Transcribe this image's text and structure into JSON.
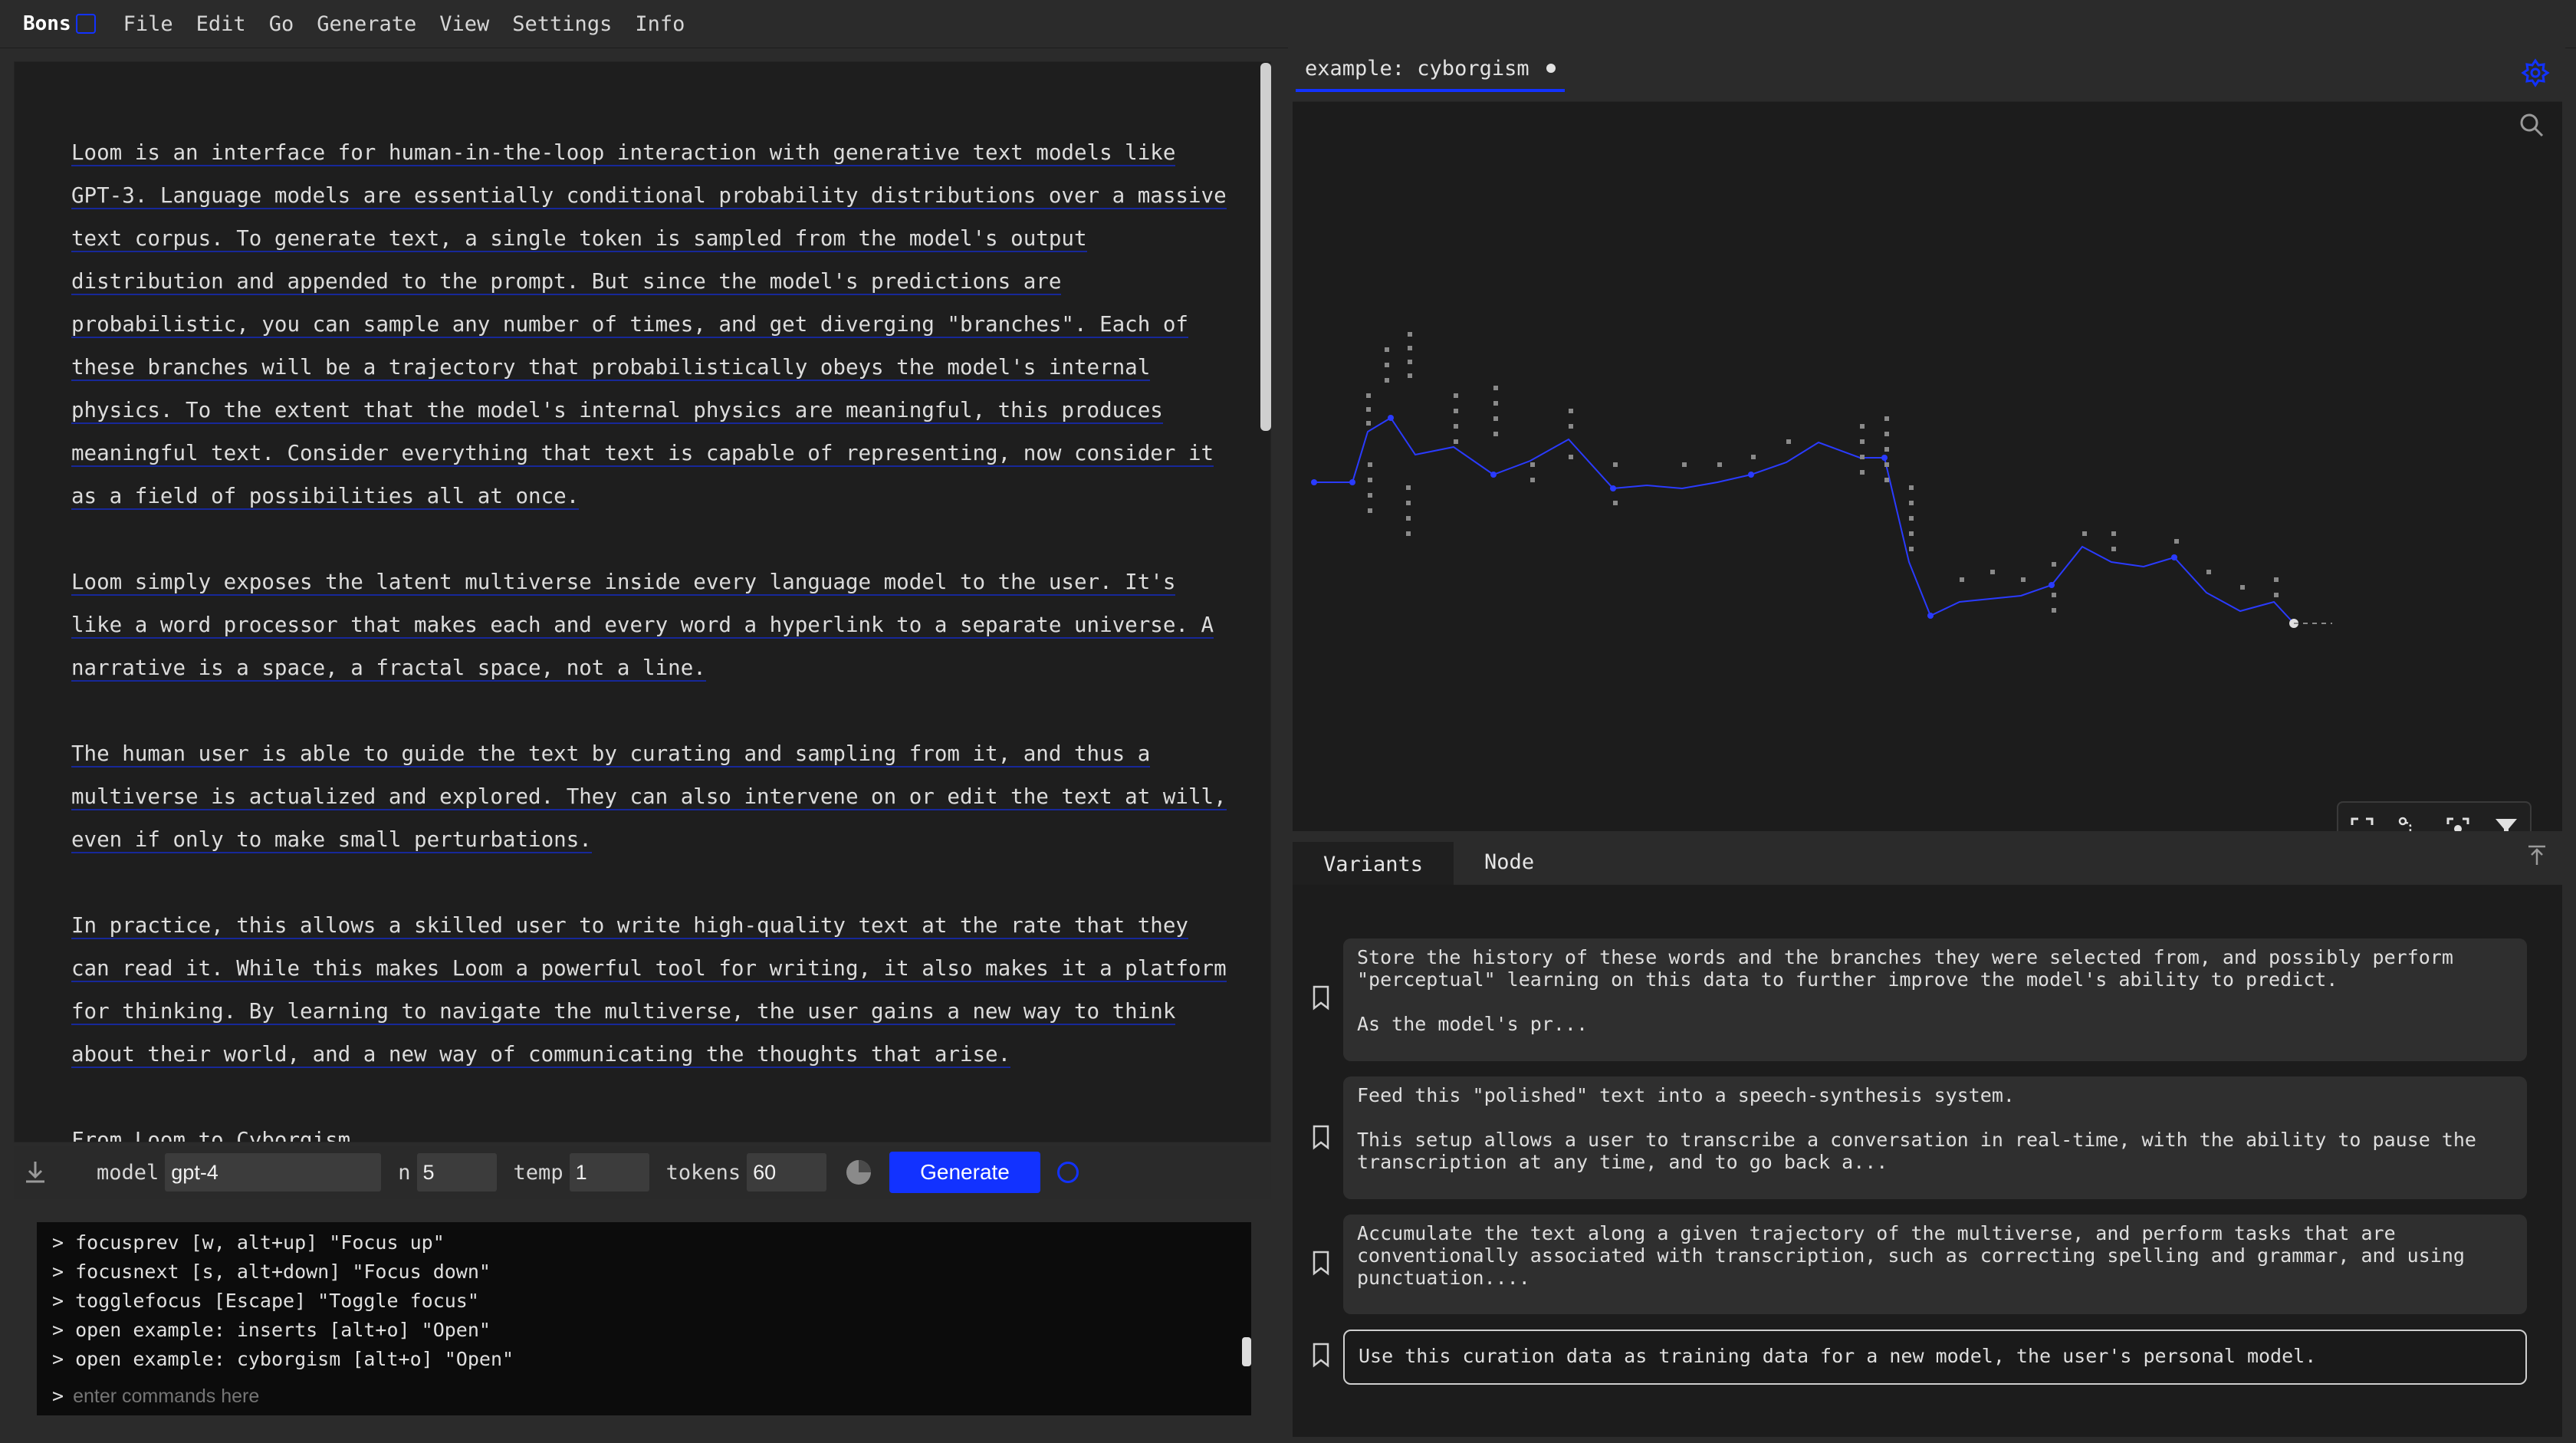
{
  "menubar": {
    "brand": "Bons",
    "items": [
      "File",
      "Edit",
      "Go",
      "Generate",
      "View",
      "Settings",
      "Info"
    ]
  },
  "editor": {
    "paragraphs": [
      "Loom is an interface for human-in-the-loop interaction with generative text models like GPT-3. Language models are essentially conditional probability distributions over a massive text corpus. To generate text, a single token is sampled from the model's output distribution and appended to the prompt. But since the model's predictions are probabilistic, you can sample any number of times, and get diverging \"branches\". Each of these branches will be a trajectory that probabilistically obeys the model's internal physics. To the extent that the model's internal physics are meaningful, this produces meaningful text. Consider everything that text is capable of representing, now consider it as a field of possibilities all at once.",
      "Loom simply exposes the latent multiverse inside every language model to the user. It's like a word processor that makes each and every word a hyperlink to a separate universe. A narrative is a space, a fractal space, not a line.",
      "The human user is able to guide the text by curating and sampling from it, and thus a multiverse is actualized and explored. They can also intervene on or edit the text at will, even if only to make small perturbations.",
      "In practice, this allows a skilled user to write high-quality text at the rate that they can read it. While this makes Loom a powerful tool for writing, it also makes it a platform for thinking. By learning to navigate the multiverse, the user gains a new way to think about their world, and a new way of communicating the thoughts that arise.",
      "From Loom to Cyborgism"
    ]
  },
  "controls": {
    "model_label": "model",
    "model_value": "gpt-4",
    "n_label": "n",
    "n_value": "5",
    "temp_label": "temp",
    "temp_value": "1",
    "tokens_label": "tokens",
    "tokens_value": "60",
    "generate_label": "Generate"
  },
  "console": {
    "lines": [
      "> focusprev [w, alt+up] \"Focus up\"",
      "> focusnext [s, alt+down] \"Focus down\"",
      "> togglefocus [Escape] \"Toggle focus\"",
      "> open example: inserts [alt+o] \"Open\"",
      "> open example: cyborgism [alt+o] \"Open\""
    ],
    "prompt": ">",
    "placeholder": "enter commands here"
  },
  "document_tab": {
    "title": "example: cyborgism"
  },
  "panel_tabs": [
    "Variants",
    "Node"
  ],
  "variants": [
    "Store the history of these words and the branches they were selected from, and possibly perform \"perceptual\" learning on this data to further improve the model's ability to predict.\n\nAs the model's pr...",
    "Feed this \"polished\" text into a speech-synthesis system.\n\nThis setup allows a user to transcribe a conversation in real-time, with the ability to pause the transcription at any time, and to go back a...",
    "Accumulate the text along a given trajectory of the multiverse, and perform tasks that are conventionally associated with transcription, such as correcting spelling and grammar, and using punctuation....",
    "Use this curation data as training data for a new model, the user's personal model."
  ],
  "colors": {
    "accent": "#1232ff",
    "panel": "#1e1e1e",
    "background": "#2b2b2b"
  },
  "icons": [
    "download-icon",
    "palette-icon",
    "loading-spinner-icon",
    "settings-gear-icon",
    "search-icon",
    "fullscreen-icon",
    "route-icon",
    "focus-icon",
    "filter-icon",
    "collapse-up-icon",
    "bookmark-icon"
  ]
}
